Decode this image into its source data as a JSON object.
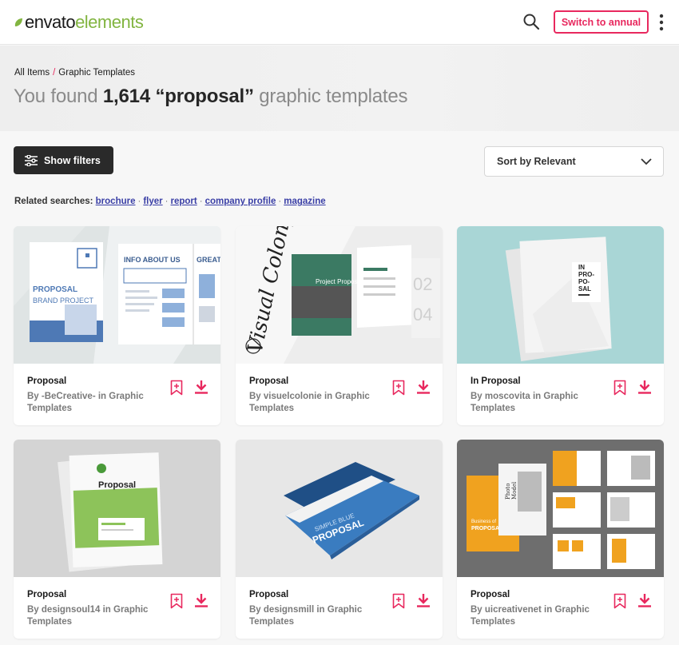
{
  "brand": {
    "part1": "envato",
    "part2": "elements",
    "accent": "#82b541"
  },
  "header": {
    "annual_button": "Switch to annual",
    "brand_color": "#e8285e"
  },
  "breadcrumb": {
    "root": "All Items",
    "separator": "/",
    "current": "Graphic Templates"
  },
  "results": {
    "prefix": "You found",
    "count": "1,614",
    "query": "“proposal”",
    "suffix": "graphic templates"
  },
  "controls": {
    "filters_label": "Show filters",
    "sort_label": "Sort by Relevant"
  },
  "related": {
    "label": "Related searches:",
    "items": [
      "brochure",
      "flyer",
      "report",
      "company profile",
      "magazine"
    ]
  },
  "cards": [
    {
      "title": "Proposal",
      "author": "By -BeCreative- in Graphic Templates",
      "thumb": {
        "brand": "PROPOSAL",
        "sub": "BRAND PROJECT",
        "head1": "INFO ABOUT US",
        "head2": "GREAT SE"
      }
    },
    {
      "title": "Proposal",
      "author": "By visuelcolonie in Graphic Templates",
      "thumb": {
        "script": "Visual Colony",
        "cover": "Project Proposal",
        "num1": "02",
        "num2": "04"
      }
    },
    {
      "title": "In Proposal",
      "author": "By moscovita in Graphic Templates",
      "thumb": {
        "l1": "IN",
        "l2": "PRO-",
        "l3": "PO-",
        "l4": "SAL"
      }
    },
    {
      "title": "Proposal",
      "author": "By designsoul14 in Graphic Templates",
      "thumb": {
        "cover": "Proposal"
      }
    },
    {
      "title": "Proposal",
      "author": "By designsmill in Graphic Templates",
      "thumb": {
        "l1": "SIMPLE BLUE",
        "l2": "PROPOSAL"
      }
    },
    {
      "title": "Proposal",
      "author": "By uicreativenet in Graphic Templates",
      "thumb": {
        "l1": "Photo",
        "l2": "Model",
        "l3": "Business of",
        "l4": "PROPOSAL"
      }
    }
  ]
}
